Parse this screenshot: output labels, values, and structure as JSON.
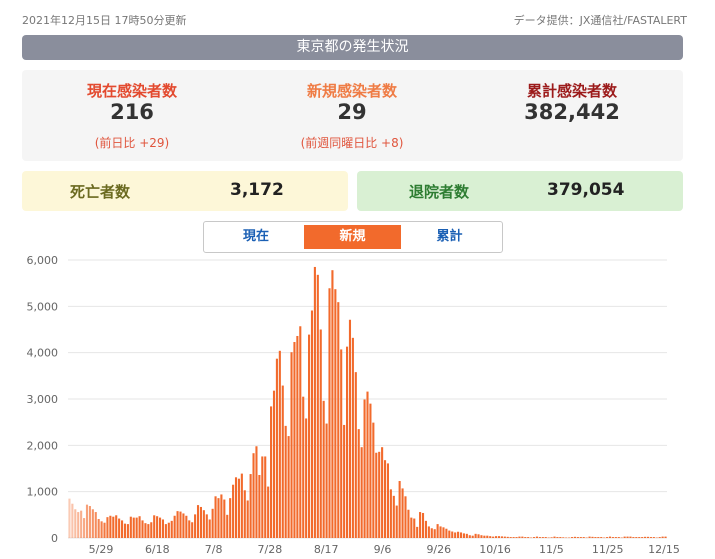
{
  "header": {
    "updated": "2021年12月15日 17時50分更新",
    "source": "データ提供：JX通信社/FASTALERT",
    "title": "東京都の発生状況"
  },
  "stats": {
    "current": {
      "label": "現在感染者数",
      "value": "216",
      "sub": "(前日比 +29)"
    },
    "new": {
      "label": "新規感染者数",
      "value": "29",
      "sub": "(前週同曜日比 +8)"
    },
    "cumulative": {
      "label": "累計感染者数",
      "value": "382,442"
    }
  },
  "deaths": {
    "label": "死亡者数",
    "value": "3,172"
  },
  "recovered": {
    "label": "退院者数",
    "value": "379,054"
  },
  "tabs": [
    {
      "label": "現在",
      "active": false
    },
    {
      "label": "新規",
      "active": true
    },
    {
      "label": "累計",
      "active": false
    }
  ],
  "colors": {
    "bar": "#f26a2c",
    "grid": "#e6e6e6",
    "tab_active": "#f26a2c",
    "title_bar": "#8a8e9c"
  },
  "chart_data": {
    "type": "bar",
    "title": "",
    "xlabel": "",
    "ylabel": "",
    "ylim": [
      0,
      6000
    ],
    "yticks": [
      "0",
      "1,000",
      "2,000",
      "3,000",
      "4,000",
      "5,000",
      "6,000"
    ],
    "xticks": [
      "5/29",
      "6/18",
      "7/8",
      "7/28",
      "8/17",
      "9/6",
      "9/26",
      "10/16",
      "11/5",
      "11/25",
      "12/15"
    ],
    "grid": true,
    "legend": "none",
    "series": [
      {
        "values": [
          850,
          740,
          620,
          560,
          590,
          430,
          720,
          690,
          620,
          560,
          410,
          360,
          330,
          450,
          480,
          460,
          490,
          420,
          380,
          310,
          300,
          460,
          440,
          440,
          470,
          380,
          320,
          300,
          340,
          490,
          470,
          440,
          400,
          300,
          330,
          370,
          480,
          580,
          570,
          530,
          480,
          380,
          340,
          510,
          710,
          670,
          600,
          510,
          400,
          630,
          900,
          860,
          940,
          830,
          500,
          860,
          1150,
          1310,
          1280,
          1390,
          1030,
          810,
          1380,
          1830,
          1980,
          1360,
          1760,
          1760,
          1110,
          2840,
          3180,
          3870,
          4040,
          3290,
          2420,
          2200,
          4010,
          4230,
          4360,
          4570,
          3050,
          2580,
          4390,
          4910,
          5850,
          5680,
          4500,
          2960,
          2470,
          5390,
          5780,
          5370,
          5090,
          4070,
          2440,
          4130,
          4710,
          4320,
          3580,
          2350,
          1960,
          2990,
          3160,
          2900,
          2490,
          1840,
          1860,
          1960,
          1680,
          1610,
          1050,
          910,
          700,
          1230,
          1070,
          900,
          610,
          440,
          420,
          240,
          560,
          540,
          370,
          250,
          210,
          190,
          300,
          250,
          230,
          200,
          160,
          140,
          120,
          135,
          120,
          100,
          90,
          60,
          50,
          90,
          80,
          60,
          50,
          50,
          40,
          30,
          40,
          40,
          35,
          30,
          25,
          20,
          20,
          20,
          30,
          30,
          20,
          20,
          10,
          20,
          30,
          20,
          20,
          20,
          10,
          15,
          30,
          20,
          20,
          15,
          10,
          10,
          20,
          25,
          20,
          20,
          20,
          10,
          30,
          25,
          20,
          20,
          20,
          10,
          20,
          30,
          20,
          20,
          20,
          10,
          30,
          30,
          30,
          20,
          20,
          20,
          20,
          25,
          25,
          20,
          20,
          10,
          20,
          30,
          30
        ]
      }
    ]
  }
}
